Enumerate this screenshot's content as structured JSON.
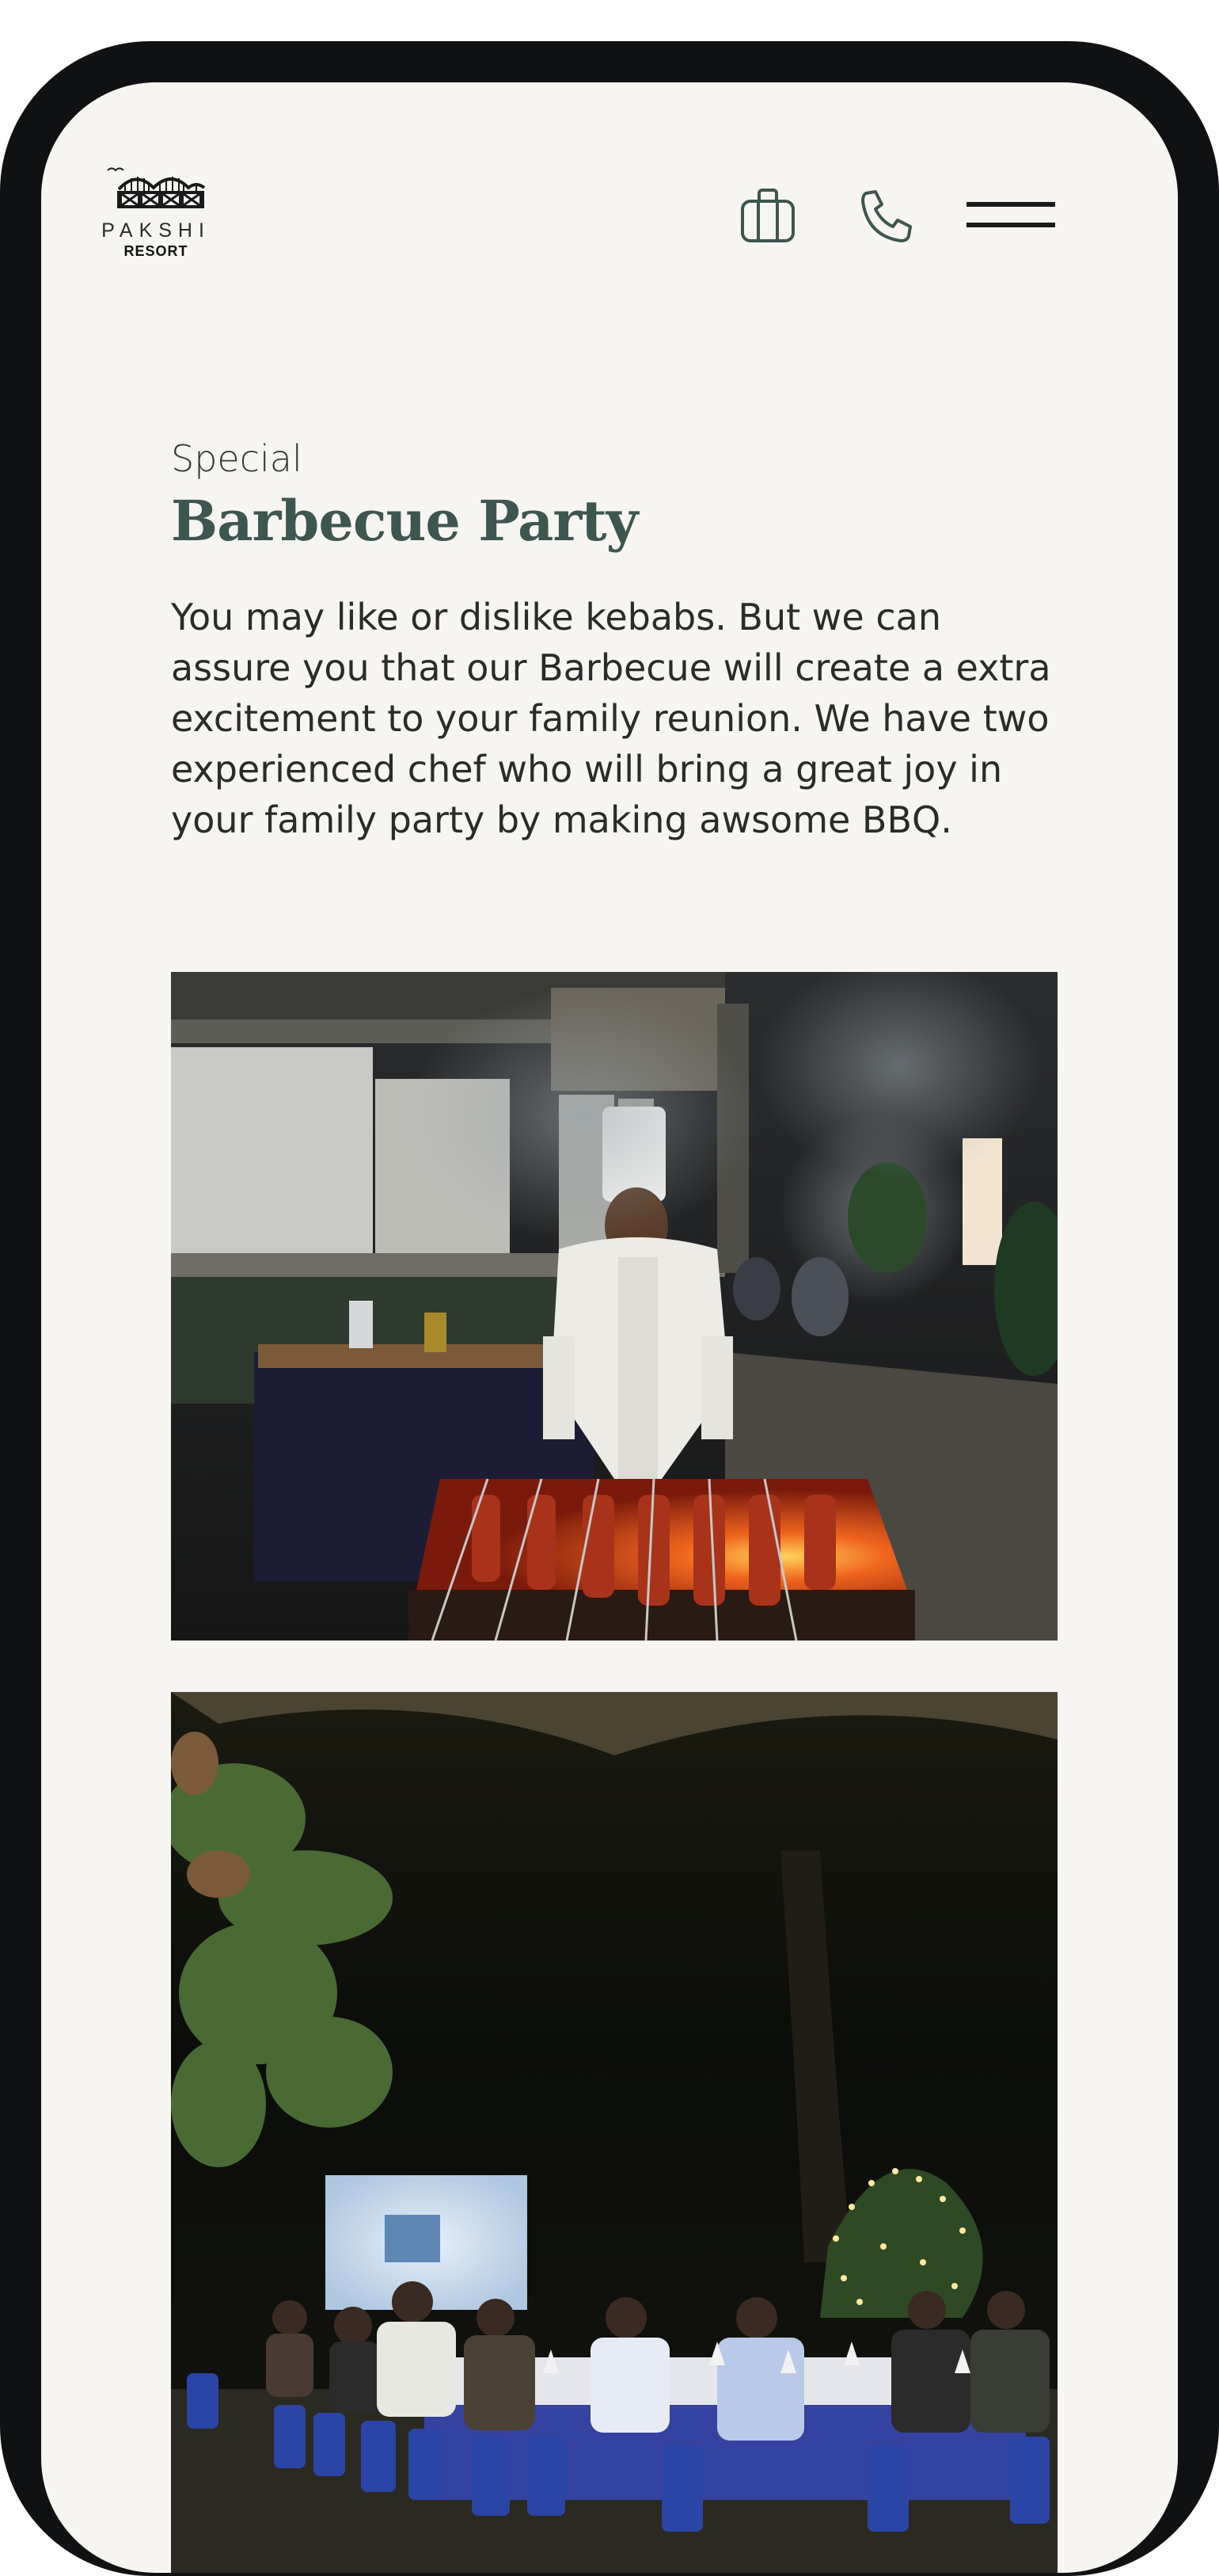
{
  "brand": {
    "name": "PAKSHI",
    "subtitle": "RESORT"
  },
  "header": {
    "icons": [
      "briefcase-icon",
      "phone-icon",
      "hamburger-menu-icon"
    ]
  },
  "section": {
    "eyebrow": "Special",
    "title": "Barbecue Party",
    "description": "You may like or dislike kebabs. But we can assure you that our Barbecue will create a extra excitement to your family reunion. We have two experienced chef who will bring a great joy in your family party by making awsome BBQ."
  },
  "colors": {
    "background": "#f7f5f1",
    "device_frame": "#0f1112",
    "title": "#3d5650",
    "icon_stroke": "#3d5650",
    "body_text": "#2b2b2b"
  }
}
